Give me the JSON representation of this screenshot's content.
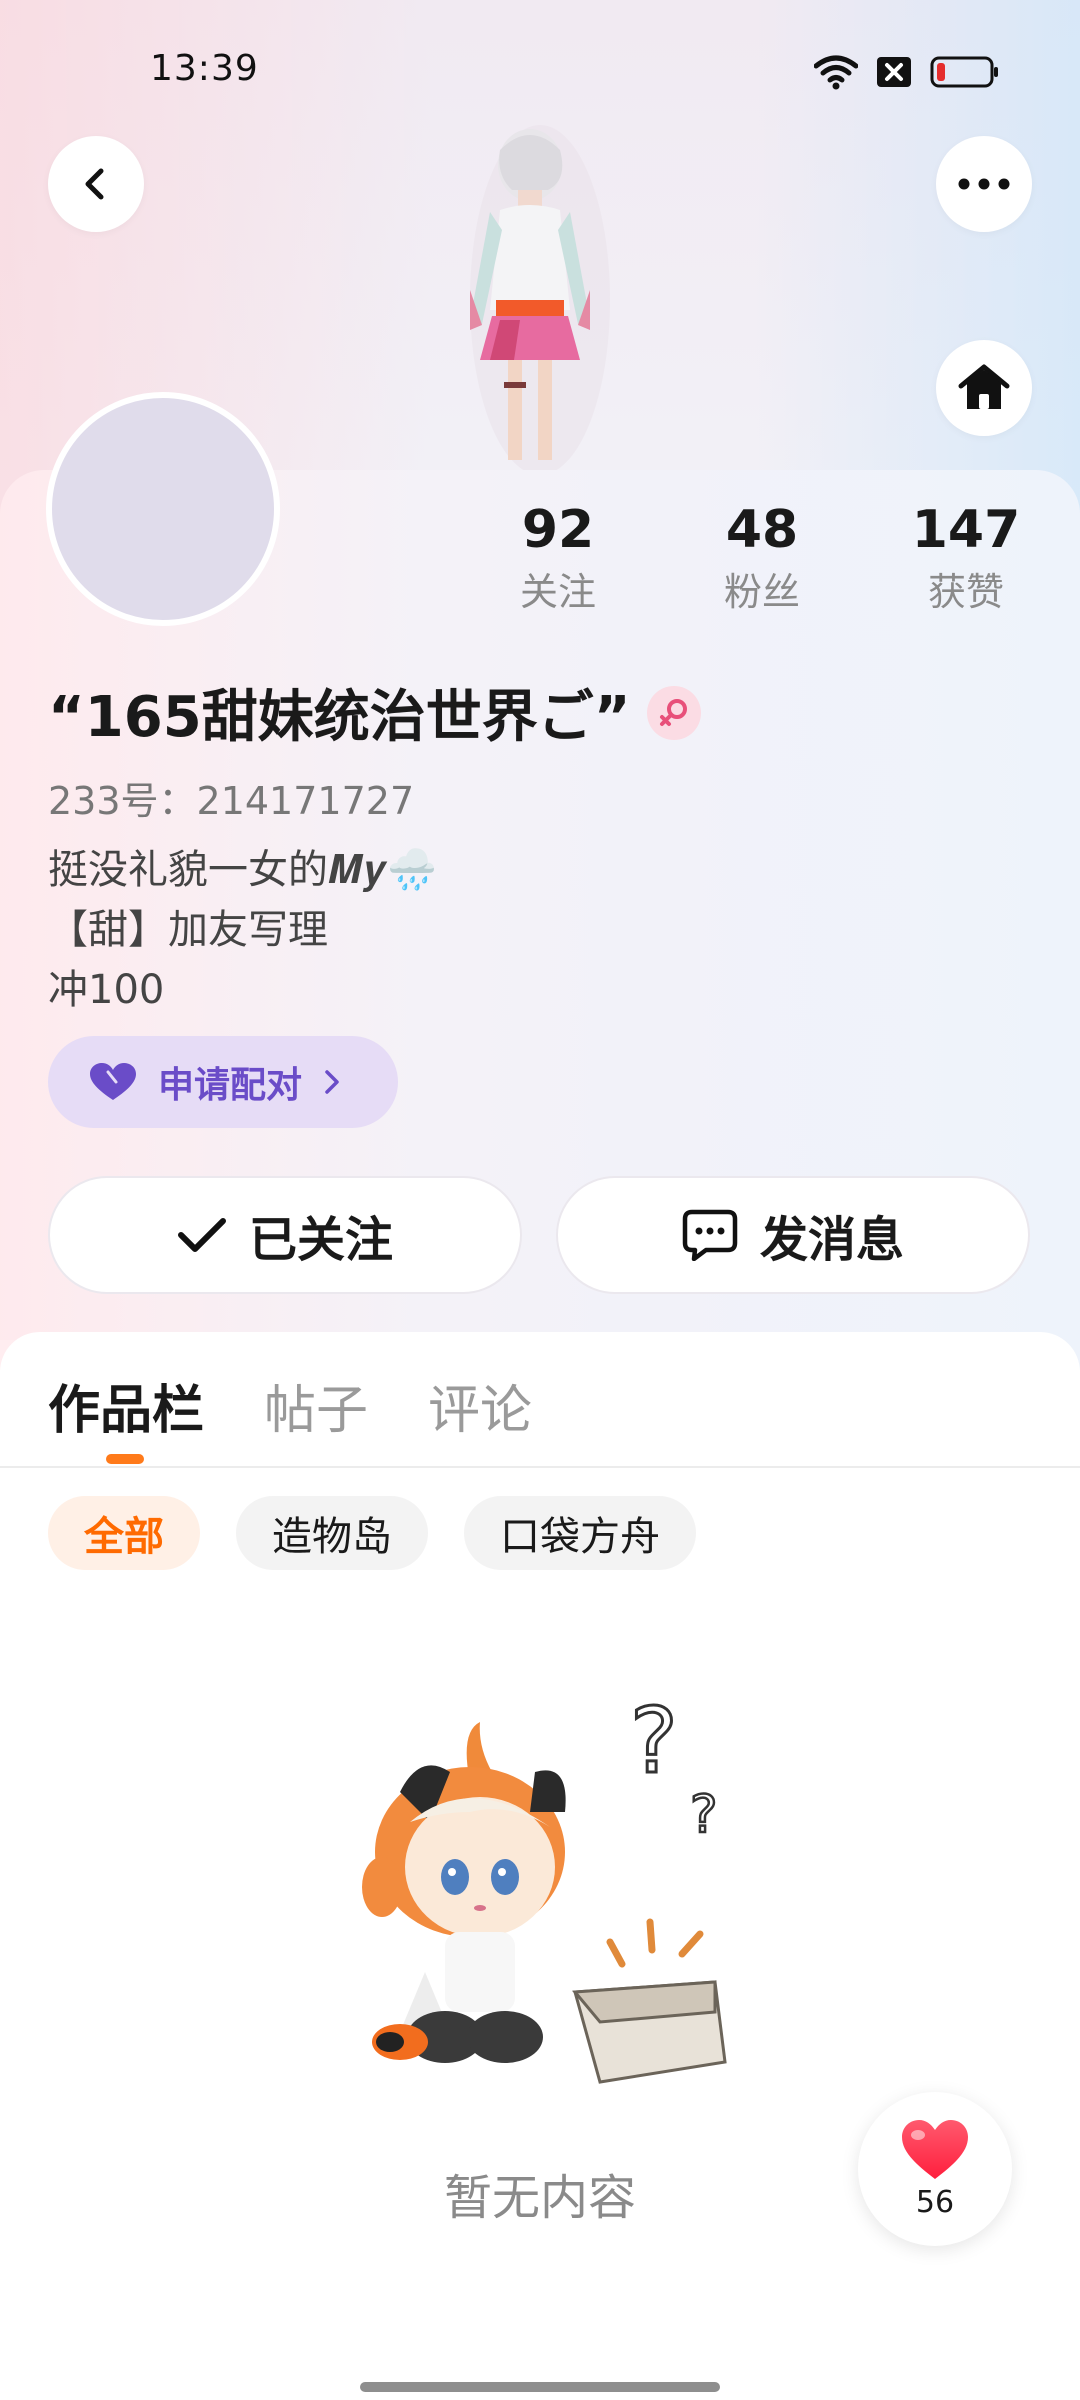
{
  "status_bar": {
    "time": "13:39"
  },
  "profile": {
    "nickname": "“165甜妹统治世界ご”",
    "id_text": "233号：214171727",
    "bio_lines": [
      "挺没礼貌一女的𝑴𝒚🌧️",
      "【甜】加友写理",
      "冲100"
    ],
    "stats": {
      "following": {
        "value": "92",
        "label": "关注"
      },
      "fans": {
        "value": "48",
        "label": "粉丝"
      },
      "likes": {
        "value": "147",
        "label": "获赞"
      }
    },
    "match_label": "申请配对",
    "follow_label": "已关注",
    "message_label": "发消息"
  },
  "tabs": [
    "作品栏",
    "帖子",
    "评论"
  ],
  "filters": [
    "全部",
    "造物岛",
    "口袋方舟"
  ],
  "empty_state": {
    "text": "暂无内容"
  },
  "like_fab": {
    "count": "56"
  },
  "colors": {
    "accent": "#ff6a00",
    "match_purple": "#6a4cc8",
    "heart_red": "#ff2d4a"
  },
  "icons": [
    "back-icon",
    "more-icon",
    "home-icon",
    "female-icon",
    "heart-icon",
    "chevron-right-icon",
    "check-icon",
    "chat-icon",
    "wifi-icon",
    "battery-icon"
  ]
}
